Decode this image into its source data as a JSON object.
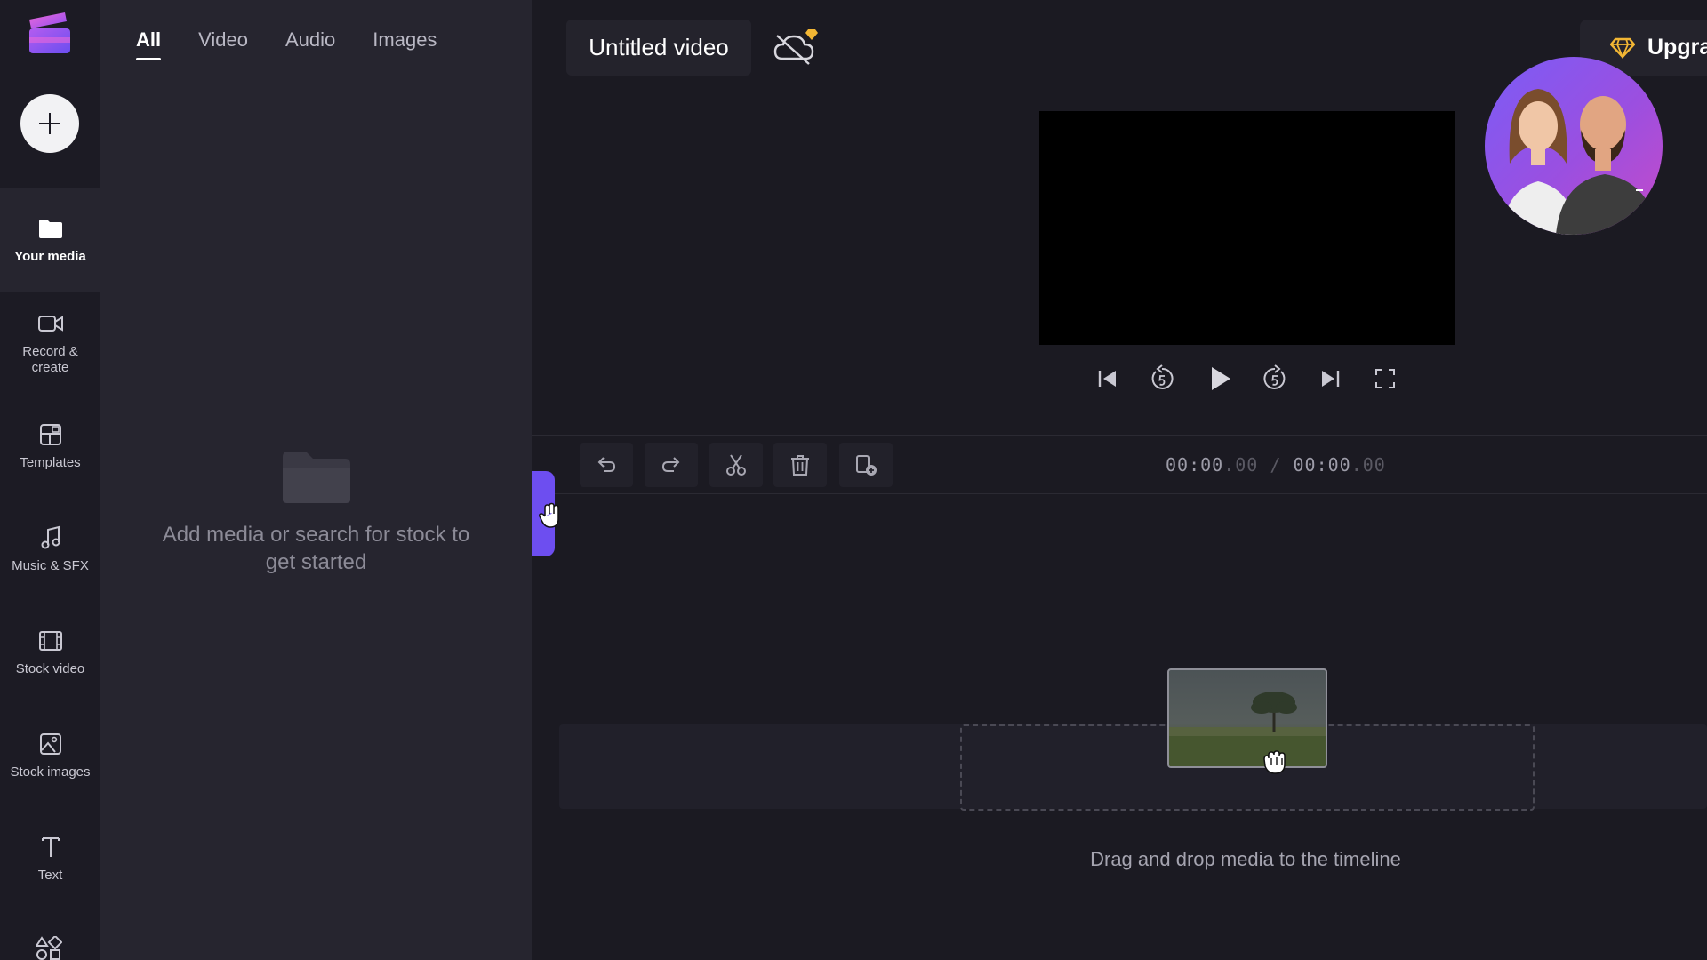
{
  "app": {
    "title": "Untitled video",
    "upgrade_label": "Upgra"
  },
  "media_tabs": [
    {
      "label": "All",
      "active": true
    },
    {
      "label": "Video",
      "active": false
    },
    {
      "label": "Audio",
      "active": false
    },
    {
      "label": "Images",
      "active": false
    }
  ],
  "sidebar": {
    "items": [
      {
        "label": "Your media",
        "icon": "folder-icon",
        "active": true
      },
      {
        "label": "Record &\ncreate",
        "icon": "camera-icon",
        "active": false
      },
      {
        "label": "Templates",
        "icon": "templates-icon",
        "active": false
      },
      {
        "label": "Music & SFX",
        "icon": "music-note-icon",
        "active": false
      },
      {
        "label": "Stock video",
        "icon": "film-icon",
        "active": false
      },
      {
        "label": "Stock images",
        "icon": "image-icon",
        "active": false
      },
      {
        "label": "Text",
        "icon": "text-icon",
        "active": false
      }
    ]
  },
  "media_panel": {
    "empty_message": "Add media or search for stock to get started"
  },
  "timecode": {
    "current": "00:00",
    "current_frac": ".00",
    "separator": "/",
    "total": "00:00",
    "total_frac": ".00"
  },
  "timeline": {
    "drop_hint": "Drag and drop media to the timeline"
  },
  "colors": {
    "accent": "#6d4ef0",
    "background": "#1b1a22",
    "panel": "#26252f",
    "upgrade_gem": "#f2b634"
  }
}
